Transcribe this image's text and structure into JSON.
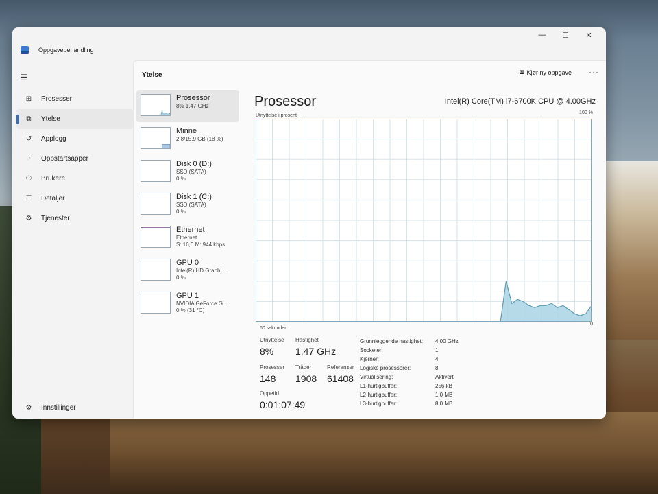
{
  "window": {
    "title": "Oppgavebehandling",
    "controls": [
      "—",
      "☐",
      "✕"
    ]
  },
  "sidebar": {
    "items": [
      {
        "label": "Prosesser",
        "icon": "grid-icon",
        "active": false
      },
      {
        "label": "Ytelse",
        "icon": "performance-icon",
        "active": true
      },
      {
        "label": "Applogg",
        "icon": "history-icon",
        "active": false
      },
      {
        "label": "Oppstartsapper",
        "icon": "speedometer-icon",
        "active": false
      },
      {
        "label": "Brukere",
        "icon": "users-icon",
        "active": false
      },
      {
        "label": "Detaljer",
        "icon": "list-icon",
        "active": false
      },
      {
        "label": "Tjenester",
        "icon": "puzzle-icon",
        "active": false
      }
    ],
    "settings_label": "Innstillinger"
  },
  "header": {
    "title": "Ytelse",
    "run_task_label": "Kjør ny oppgave",
    "more_label": "···"
  },
  "devices": [
    {
      "name": "Prosessor",
      "lines": [
        "8% 1,47 GHz"
      ],
      "selected": true
    },
    {
      "name": "Minne",
      "lines": [
        "2,8/15,9 GB (18 %)"
      ],
      "selected": false
    },
    {
      "name": "Disk 0 (D:)",
      "lines": [
        "SSD (SATA)",
        "0 %"
      ],
      "selected": false
    },
    {
      "name": "Disk 1 (C:)",
      "lines": [
        "SSD (SATA)",
        "0 %"
      ],
      "selected": false
    },
    {
      "name": "Ethernet",
      "lines": [
        "Ethernet",
        "S: 16,0 M: 944 kbps"
      ],
      "selected": false
    },
    {
      "name": "GPU 0",
      "lines": [
        "Intel(R) HD Graphi...",
        "0 %"
      ],
      "selected": false
    },
    {
      "name": "GPU 1",
      "lines": [
        "NVIDIA GeForce G...",
        "0 % (31 °C)"
      ],
      "selected": false
    }
  ],
  "detail": {
    "title": "Prosessor",
    "model": "Intel(R) Core(TM) i7-6700K CPU @ 4.00GHz",
    "graph_label": "Utnyttelse i prosent",
    "graph_max": "100 %",
    "graph_time": "60 sekunder",
    "graph_min": "0",
    "utilization_history": [
      0,
      0,
      0,
      0,
      0,
      0,
      0,
      0,
      0,
      0,
      0,
      0,
      0,
      0,
      0,
      0,
      0,
      0,
      0,
      0,
      0,
      0,
      0,
      0,
      0,
      0,
      0,
      0,
      0,
      0,
      0,
      0,
      0,
      0,
      0,
      0,
      0,
      0,
      0,
      0,
      0,
      0,
      0,
      0,
      20,
      9,
      11,
      10,
      8,
      7,
      8,
      8,
      9,
      7,
      8,
      6,
      4,
      3,
      4,
      8
    ],
    "stats": {
      "utilization_label": "Utnyttelse",
      "utilization_value": "8%",
      "speed_label": "Hastighet",
      "speed_value": "1,47 GHz",
      "processes_label": "Prosesser",
      "processes_value": "148",
      "threads_label": "Tråder",
      "threads_value": "1908",
      "handles_label": "Referanser",
      "handles_value": "61408",
      "uptime_label": "Oppetid",
      "uptime_value": "0:01:07:49"
    },
    "specs": [
      {
        "label": "Grunnleggende hastighet:",
        "value": "4,00 GHz"
      },
      {
        "label": "Socketer:",
        "value": "1"
      },
      {
        "label": "Kjerner:",
        "value": "4"
      },
      {
        "label": "Logiske prosessorer:",
        "value": "8"
      },
      {
        "label": "Virtualisering:",
        "value": "Aktivert"
      },
      {
        "label": "L1-hurtigbuffer:",
        "value": "256 kB"
      },
      {
        "label": "L2-hurtigbuffer:",
        "value": "1,0 MB"
      },
      {
        "label": "L3-hurtigbuffer:",
        "value": "8,0 MB"
      }
    ]
  },
  "colors": {
    "graph_line": "#5b9bb5",
    "graph_fill": "#a9d3e3",
    "graph_grid": "#d6e3ea",
    "graph_border": "#7fa7bd",
    "accent": "#2f6fc7"
  }
}
